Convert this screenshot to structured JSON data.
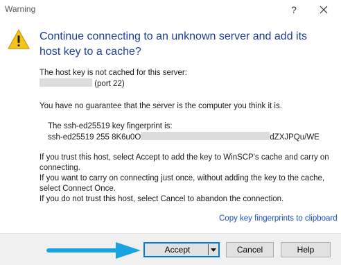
{
  "window": {
    "title": "Warning",
    "help_glyph": "?",
    "close_icon": "close-icon"
  },
  "icon": "warning-triangle-icon",
  "heading": "Continue connecting to an unknown server and add its host key to a cache?",
  "host_section": {
    "line1": "The host key is not cached for this server:",
    "port": "(port 22)"
  },
  "guarantee": "You have no guarantee that the server is the computer you think it is.",
  "fingerprint": {
    "label": "The ssh-ed25519 key fingerprint is:",
    "prefix": "ssh-ed25519 255 8K6u0O",
    "suffix": "dZXJPQu/WE"
  },
  "instructions": {
    "line1": "If you trust this host, select Accept to add the key to WinSCP's cache and carry on connecting.",
    "line2": "If you want to carry on connecting just once, without adding the key to the cache, select Connect Once.",
    "line3": "If you do not trust this host, select Cancel to abandon the connection."
  },
  "copy_link": "Copy key fingerprints to clipboard",
  "buttons": {
    "accept": "Accept",
    "cancel": "Cancel",
    "help": "Help"
  },
  "colors": {
    "heading": "#1c3f94",
    "link": "#1a4fc4",
    "focus_border": "#0078d7",
    "annotation_arrow": "#1aa3e0",
    "warning_fill": "#f7c21b"
  }
}
